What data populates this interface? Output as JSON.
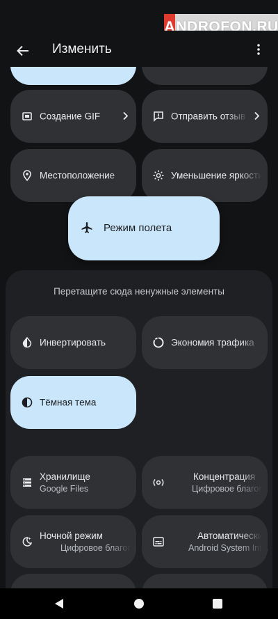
{
  "watermark": {
    "first": "A",
    "rest": "NDROFON.RU"
  },
  "header": {
    "title": "Изменить"
  },
  "active_tiles": [
    {
      "label": "Создание GIF"
    },
    {
      "label": "Отправить отзыв"
    },
    {
      "label": "Местоположение"
    },
    {
      "label": "Уменьшение яркости"
    }
  ],
  "dragging_tile": {
    "label": "Режим полета"
  },
  "removal_area": {
    "hint": "Перетащите сюда ненужные элементы"
  },
  "available_tiles": [
    {
      "label": "Инвертировать"
    },
    {
      "label": "Экономия трафика"
    },
    {
      "label": "Тёмная тема"
    },
    {
      "label": "Хранилище",
      "sub": "Google Files"
    },
    {
      "label": "Концентрация",
      "sub": "Цифровое благополучие"
    },
    {
      "label": "Ночной режим",
      "sub": "Цифровое благополучие"
    },
    {
      "label": "Автоматические субтитры",
      "sub": "Android System Intelligence"
    }
  ],
  "colors": {
    "background": "#121315",
    "tile": "#2f3135",
    "tile_active": "#c9e6fb",
    "panel": "#1f2023"
  }
}
